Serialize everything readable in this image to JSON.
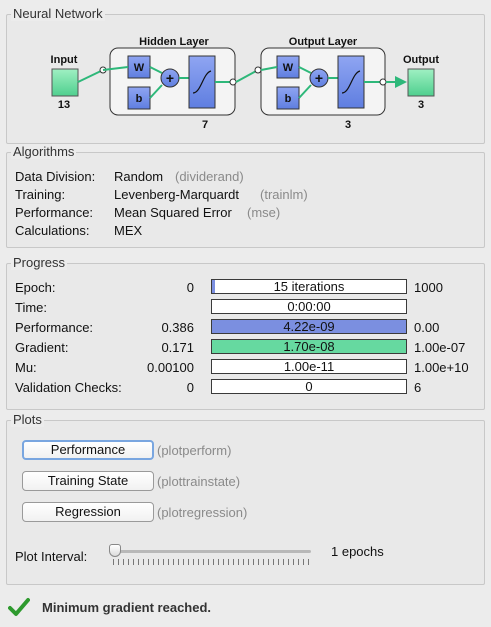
{
  "network": {
    "title": "Neural Network",
    "input_label": "Input",
    "input_size": "13",
    "hidden_label": "Hidden Layer",
    "hidden_size": "7",
    "output_layer_label": "Output Layer",
    "output_layer_size": "3",
    "output_label": "Output",
    "output_size": "3",
    "w_label": "W",
    "b_label": "b",
    "sum_symbol": "+"
  },
  "algorithms": {
    "title": "Algorithms",
    "rows": [
      {
        "label": "Data Division:",
        "value": "Random",
        "fn": "(dividerand)"
      },
      {
        "label": "Training:",
        "value": "Levenberg-Marquardt",
        "fn": "(trainlm)"
      },
      {
        "label": "Performance:",
        "value": "Mean Squared Error",
        "fn": "(mse)"
      },
      {
        "label": "Calculations:",
        "value": "MEX",
        "fn": ""
      }
    ]
  },
  "progress": {
    "title": "Progress",
    "rows": [
      {
        "label": "Epoch:",
        "start": "0",
        "text": "15 iterations",
        "end": "1000",
        "fill": 0.015,
        "color": "#7b8fe0"
      },
      {
        "label": "Time:",
        "start": "",
        "text": "0:00:00",
        "end": "",
        "fill": 0,
        "color": "#7b8fe0"
      },
      {
        "label": "Performance:",
        "start": "0.386",
        "text": "4.22e-09",
        "end": "0.00",
        "fill": 1.0,
        "color": "#7b8fe0"
      },
      {
        "label": "Gradient:",
        "start": "0.171",
        "text": "1.70e-08",
        "end": "1.00e-07",
        "fill": 1.0,
        "color": "#66d9a0"
      },
      {
        "label": "Mu:",
        "start": "0.00100",
        "text": "1.00e-11",
        "end": "1.00e+10",
        "fill": 0,
        "color": "#7b8fe0"
      },
      {
        "label": "Validation Checks:",
        "start": "0",
        "text": "0",
        "end": "6",
        "fill": 0,
        "color": "#7b8fe0"
      }
    ]
  },
  "plots": {
    "title": "Plots",
    "buttons": [
      {
        "label": "Performance",
        "fn": "(plotperform)"
      },
      {
        "label": "Training State",
        "fn": "(plottrainstate)"
      },
      {
        "label": "Regression",
        "fn": "(plotregression)"
      }
    ],
    "interval_label": "Plot Interval:",
    "interval_value": "1 epochs",
    "slider_fraction": 0
  },
  "status": {
    "text": "Minimum gradient reached.",
    "icon": "checkmark-icon",
    "color": "#2e9a2e"
  }
}
